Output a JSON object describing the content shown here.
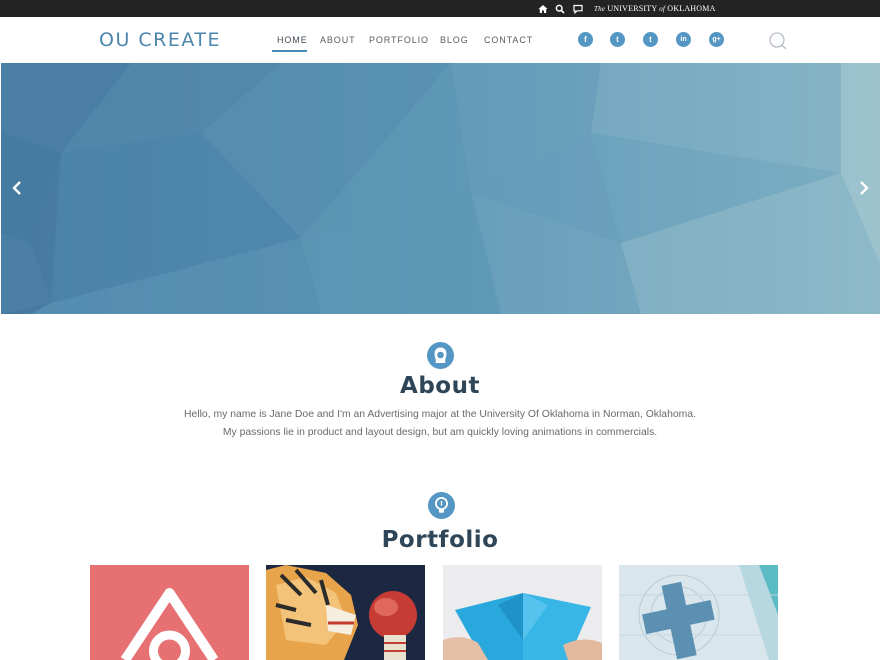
{
  "topbar": {
    "icons": [
      "home-icon",
      "search-icon",
      "comment-icon"
    ],
    "institution_prefix": "The",
    "institution_first": "UNIVERSITY",
    "institution_of": "of",
    "institution_last": "OKLAHOMA"
  },
  "header": {
    "logo": "OU CREATE",
    "nav": [
      "HOME",
      "ABOUT",
      "PORTFOLIO",
      "BLOG",
      "CONTACT"
    ],
    "active_nav": "HOME",
    "social": [
      {
        "name": "facebook-icon",
        "glyph": "f"
      },
      {
        "name": "twitter-icon",
        "glyph": "t"
      },
      {
        "name": "tumblr-icon",
        "glyph": "t"
      },
      {
        "name": "linkedin-icon",
        "glyph": "in"
      },
      {
        "name": "google-plus-icon",
        "glyph": "g+"
      }
    ]
  },
  "hero": {
    "icons": [
      "chevron-left-icon",
      "chevron-right-icon"
    ],
    "colors": {
      "base": "#5a8fb1",
      "light": "#9fc4cf",
      "dark": "#46769e"
    }
  },
  "about": {
    "icon": "person-icon",
    "title": "About",
    "line1": "Hello, my name is Jane Doe and I'm an Advertising major at the University Of Oklahoma in Norman, Oklahoma.",
    "line2": "My passions lie in product and layout design, but am quickly loving animations in commercials."
  },
  "portfolio": {
    "icon": "lightbulb-icon",
    "title": "Portfolio",
    "items": [
      "airbnb-logo-thumbnail",
      "tiger-boxing-illustration-thumbnail",
      "paper-airplane-photo-thumbnail",
      "cross-logo-thumbnail"
    ]
  },
  "colors": {
    "accent": "#5597c4",
    "logo": "#4c86ad",
    "heading": "#2f4658",
    "topbar": "#232323"
  }
}
